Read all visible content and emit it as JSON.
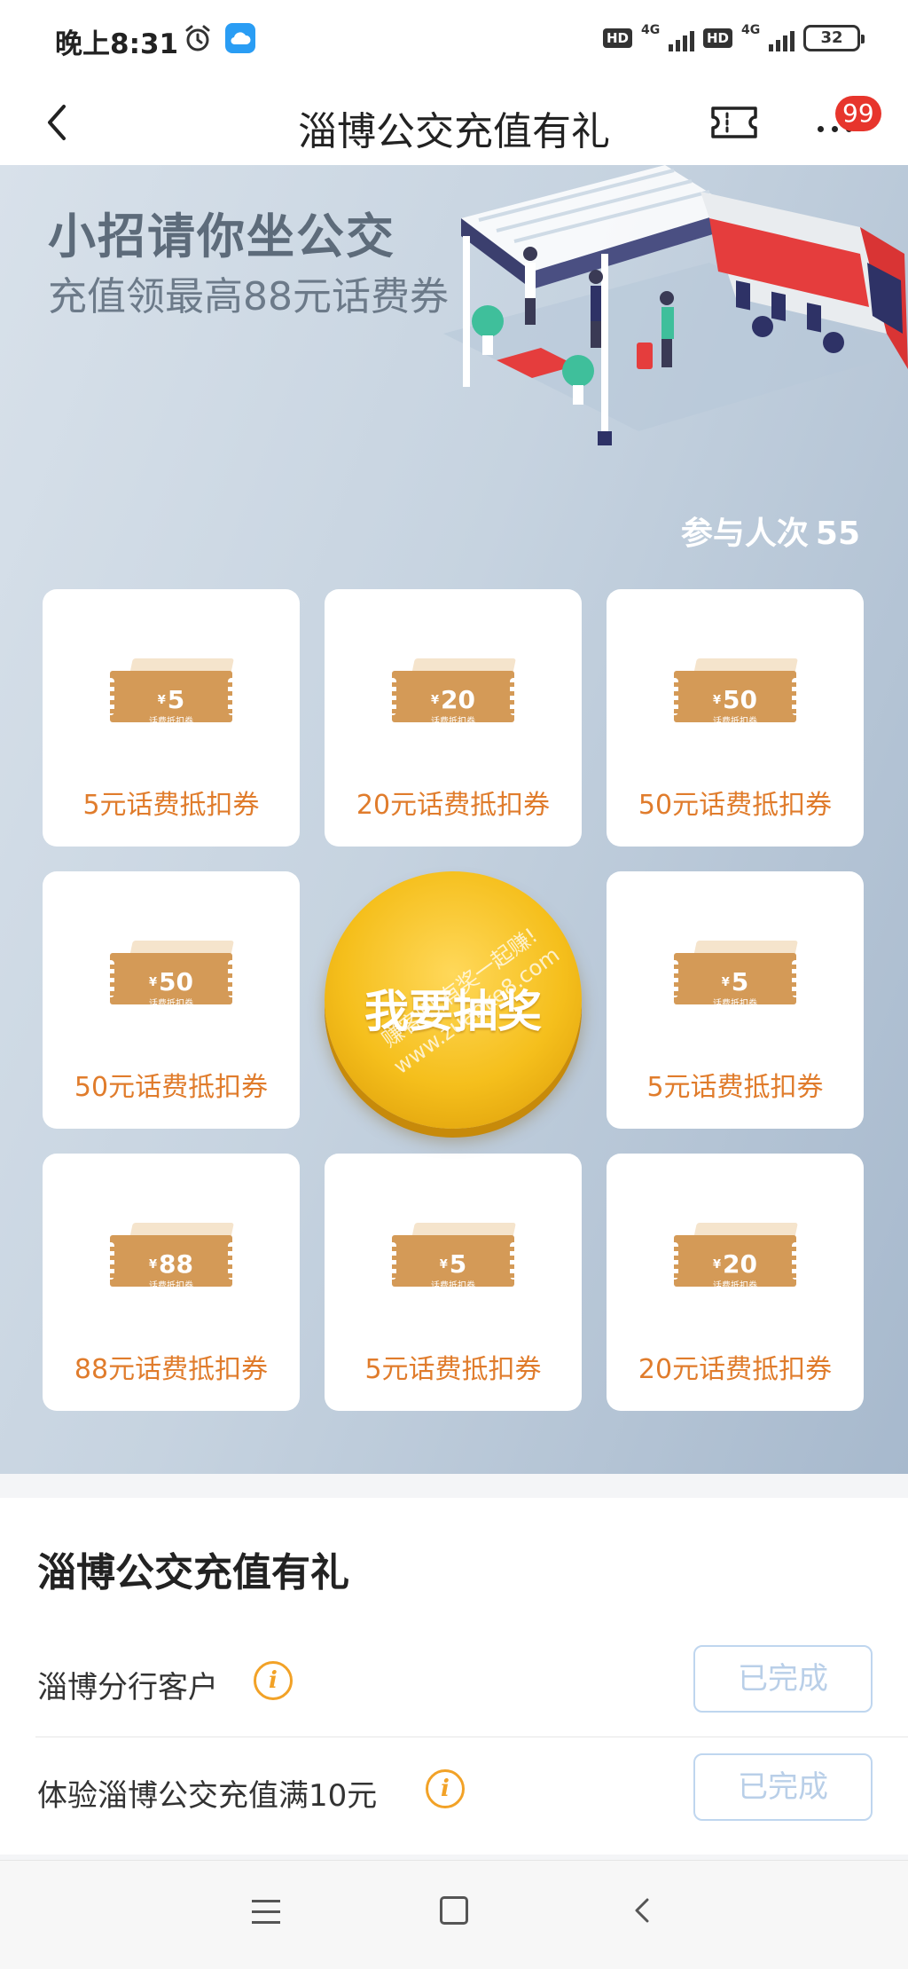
{
  "status_bar": {
    "time": "晚上8:31",
    "network_1": "4G",
    "network_2": "4G",
    "hd_1": "HD",
    "hd_2": "HD",
    "battery": "32"
  },
  "nav": {
    "title": "淄博公交充值有礼",
    "badge": "99"
  },
  "banner": {
    "title": "小招请你坐公交",
    "subtitle": "充值领最高88元话费券",
    "participants_label": "参与人次",
    "participants_count": "55",
    "watermark": "赚客吧,有奖一起赚! www.zuanke8.com"
  },
  "prizes": [
    {
      "amount": "5",
      "label": "5元话费抵扣券"
    },
    {
      "amount": "20",
      "label": "20元话费抵扣券"
    },
    {
      "amount": "50",
      "label": "50元话费抵扣券"
    },
    {
      "amount": "50",
      "label": "50元话费抵扣券"
    },
    {
      "amount": "5",
      "label": "5元话费抵扣券"
    },
    {
      "amount": "88",
      "label": "88元话费抵扣券"
    },
    {
      "amount": "5",
      "label": "5元话费抵扣券"
    },
    {
      "amount": "20",
      "label": "20元话费抵扣券"
    }
  ],
  "coupon": {
    "currency": "¥",
    "caption": "话费抵扣券"
  },
  "draw_button": "我要抽奖",
  "tasks": {
    "title": "淄博公交充值有礼",
    "items": [
      {
        "text": "淄博分行客户",
        "status": "已完成"
      },
      {
        "text": "体验淄博公交充值满10元",
        "status": "已完成"
      }
    ]
  },
  "colors": {
    "accent_orange": "#e07c2c",
    "coupon_gold": "#d49a57",
    "draw_button_gold": "#f5bf1c",
    "badge_red": "#e7352c",
    "done_border": "#bfd6ef"
  }
}
